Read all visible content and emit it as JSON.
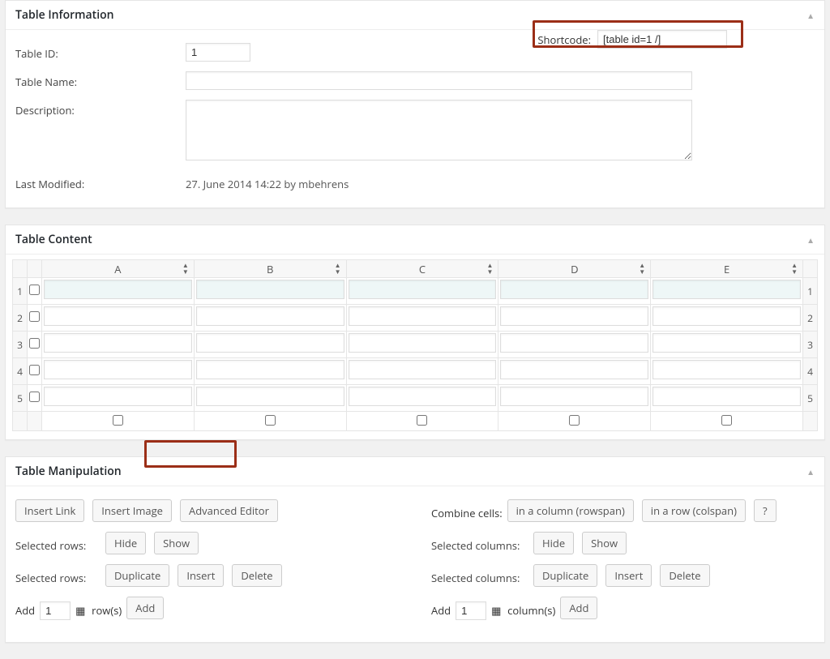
{
  "table_info": {
    "heading": "Table Information",
    "labels": {
      "table_id": "Table ID:",
      "table_name": "Table Name:",
      "description": "Description:",
      "last_modified": "Last Modified:",
      "shortcode": "Shortcode:"
    },
    "table_id": "1",
    "table_name": "",
    "description": "",
    "last_modified": "27. June 2014 14:22 by mbehrens",
    "shortcode": "[table id=1 /]"
  },
  "table_content": {
    "heading": "Table Content",
    "columns": [
      "A",
      "B",
      "C",
      "D",
      "E"
    ],
    "rows": [
      "1",
      "2",
      "3",
      "4",
      "5"
    ]
  },
  "manipulation": {
    "heading": "Table Manipulation",
    "insert_link": "Insert Link",
    "insert_image": "Insert Image",
    "advanced_editor": "Advanced Editor",
    "combine_cells": "Combine cells:",
    "rowspan_btn": "in a column (rowspan)",
    "colspan_btn": "in a row (colspan)",
    "help_btn": "?",
    "selected_rows": "Selected rows:",
    "selected_columns": "Selected columns:",
    "hide": "Hide",
    "show": "Show",
    "duplicate": "Duplicate",
    "insert": "Insert",
    "delete": "Delete",
    "add": "Add",
    "rows_unit": "row(s)",
    "cols_unit": "column(s)",
    "add_rows_val": "1",
    "add_cols_val": "1",
    "add_btn": "Add"
  }
}
